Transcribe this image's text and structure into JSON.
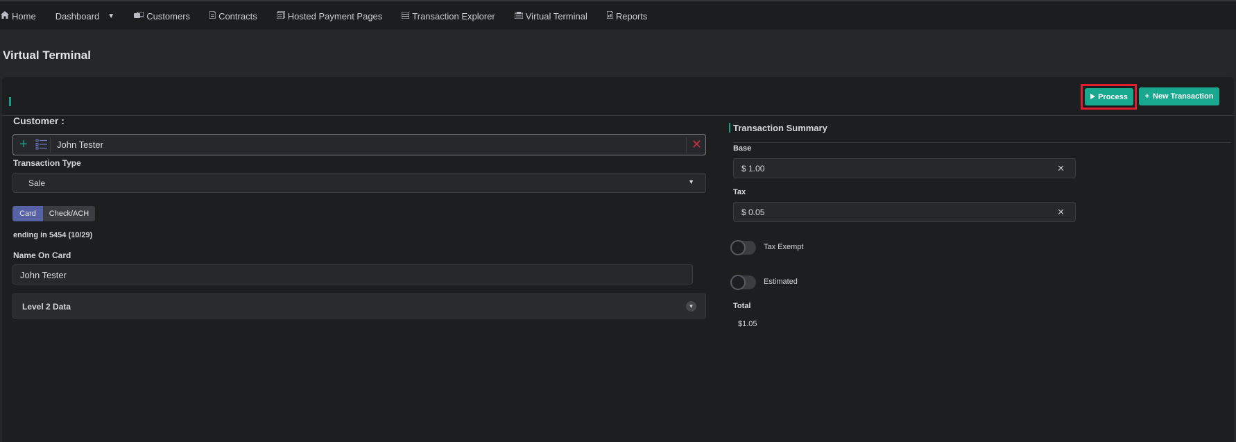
{
  "nav": {
    "items": [
      {
        "label": "Home",
        "icon": "home-icon"
      },
      {
        "label": "Dashboard",
        "icon": "",
        "has_dropdown": true
      },
      {
        "label": "Customers",
        "icon": "customers-icon"
      },
      {
        "label": "Contracts",
        "icon": "document-icon"
      },
      {
        "label": "Hosted Payment Pages",
        "icon": "pages-icon"
      },
      {
        "label": "Transaction Explorer",
        "icon": "table-icon"
      },
      {
        "label": "Virtual Terminal",
        "icon": "terminal-icon"
      },
      {
        "label": "Reports",
        "icon": "report-icon"
      }
    ]
  },
  "page": {
    "title": "Virtual Terminal"
  },
  "toolbar": {
    "process_label": "Process",
    "new_transaction_label": "New Transaction"
  },
  "form": {
    "customer_label": "Customer :",
    "customer_value": "John Tester",
    "transaction_type_label": "Transaction Type",
    "transaction_type_value": "Sale",
    "payment_tabs": [
      "Card",
      "Check/ACH"
    ],
    "active_payment_tab": "Card",
    "card_ending": "ending in 5454 (10/29)",
    "name_on_card_label": "Name On Card",
    "name_on_card_value": "John Tester",
    "level2_label": "Level 2 Data"
  },
  "summary": {
    "title": "Transaction Summary",
    "base_label": "Base",
    "base_value": "$ 1.00",
    "tax_label": "Tax",
    "tax_value": "$ 0.05",
    "tax_exempt_label": "Tax Exempt",
    "estimated_label": "Estimated",
    "total_label": "Total",
    "total_value": "$1.05"
  },
  "colors": {
    "accent": "#17a88f",
    "active_tab": "#5761a5",
    "highlight": "#e01e2d"
  }
}
